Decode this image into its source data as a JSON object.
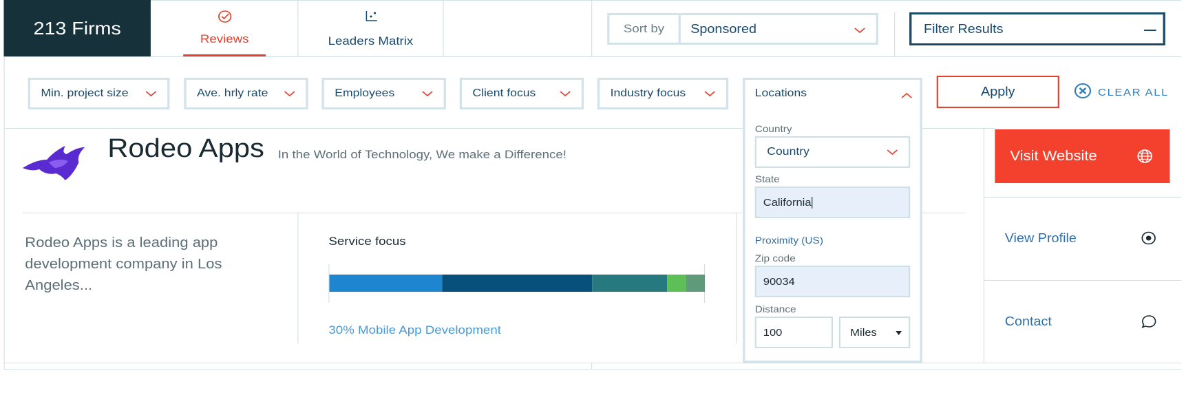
{
  "header": {
    "firm_count": "213 Firms",
    "tabs": [
      {
        "label": "Reviews",
        "icon": "check-circle-icon",
        "active": true
      },
      {
        "label": "Leaders Matrix",
        "icon": "matrix-icon",
        "active": false
      }
    ],
    "sort": {
      "label": "Sort by",
      "value": "Sponsored"
    },
    "filter_results": "Filter Results"
  },
  "filters": [
    "Min. project size",
    "Ave. hrly rate",
    "Employees",
    "Client focus",
    "Industry focus"
  ],
  "locations": {
    "title": "Locations",
    "country_label": "Country",
    "country_value": "Country",
    "state_label": "State",
    "state_value": "California",
    "proximity_label": "Proximity (US)",
    "zip_label": "Zip code",
    "zip_value": "90034",
    "distance_label": "Distance",
    "distance_value": "100",
    "distance_unit": "Miles"
  },
  "apply_label": "Apply",
  "clear_all_label": "CLEAR ALL",
  "listing": {
    "name": "Rodeo Apps",
    "tagline": "In the World of Technology, We make a Difference!",
    "description": "Rodeo Apps is a leading app development company in Los Angeles...",
    "service_focus_title": "Service focus",
    "service_focus_legend": "30%  Mobile App Development",
    "service_focus_segments": [
      {
        "share": 30,
        "color": "#1e86d0"
      },
      {
        "share": 40,
        "color": "#08507c"
      },
      {
        "share": 20,
        "color": "#25797f"
      },
      {
        "share": 5,
        "color": "#5dbf55"
      },
      {
        "share": 5,
        "color": "#5f9a7a"
      }
    ],
    "visit_website": "Visit Website",
    "view_profile": "View Profile",
    "contact": "Contact"
  },
  "colors": {
    "accent_red": "#e6422f",
    "navy": "#17313b",
    "link_blue": "#2f6fa8"
  }
}
